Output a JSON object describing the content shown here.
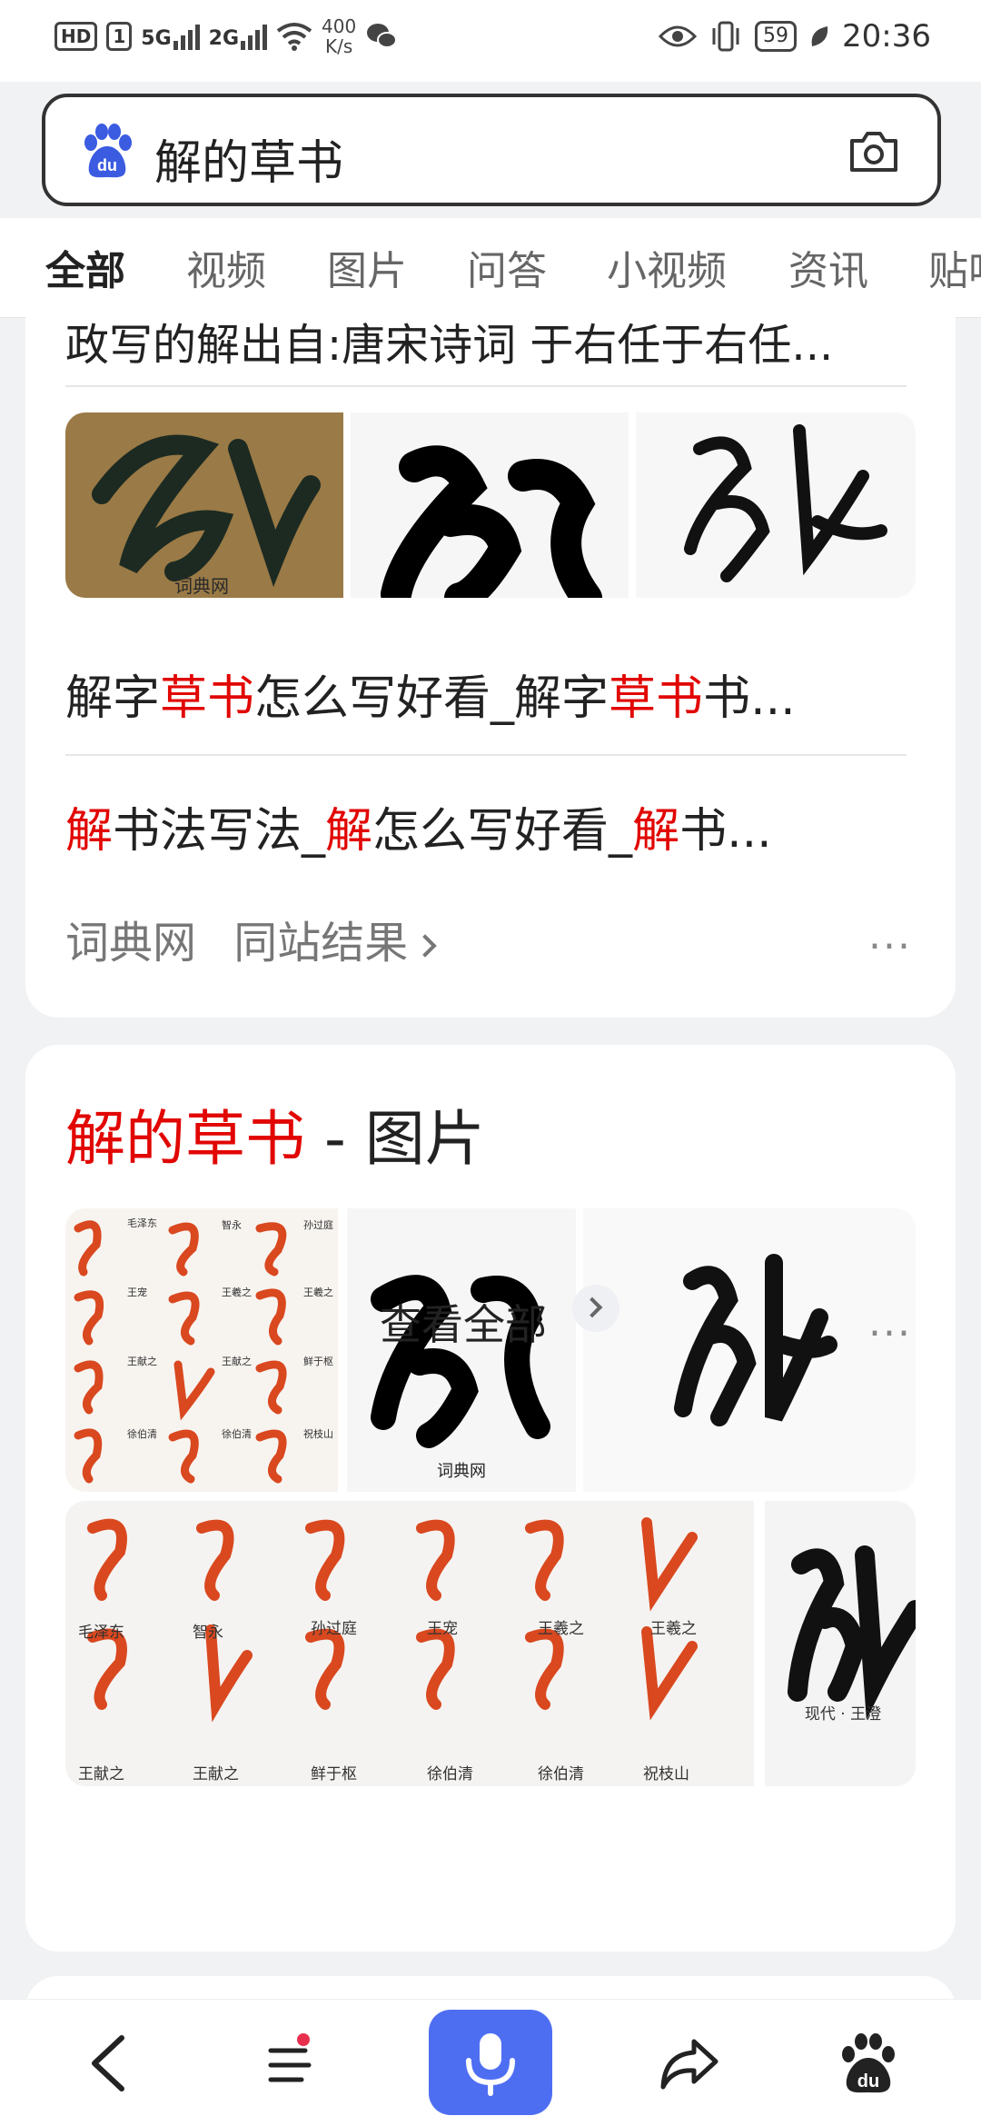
{
  "status_bar": {
    "hd": "HD",
    "sim1": "1",
    "net1": "5G",
    "net2": "2G",
    "speed_value": "400",
    "speed_unit": "K/s",
    "battery": "59",
    "time": "20:36"
  },
  "search": {
    "query": "解的草书"
  },
  "tabs": [
    "全部",
    "视频",
    "图片",
    "问答",
    "小视频",
    "资讯",
    "贴吧"
  ],
  "card1": {
    "cut_text": "政写的解出自:唐宋诗词 于右任于右任...",
    "thumb_watermark": "词典网",
    "link1": {
      "p1": "解字",
      "h1": "草书",
      "p2": "怎么写好看_解字",
      "h2": "草书",
      "p3": "书..."
    },
    "link2": {
      "h1": "解",
      "p1": "书法写法_",
      "h2": "解",
      "p2": "怎么写好看_",
      "h3": "解",
      "p3": "书..."
    },
    "source_name": "词典网",
    "same_site": "同站结果",
    "more": "..."
  },
  "card2": {
    "title_highlight": "解的草书",
    "title_rest": " - 图片",
    "grid_labels": [
      "毛泽东",
      "智永",
      "孙过庭",
      "王宠",
      "王羲之",
      "王羲之",
      "王献之",
      "王献之",
      "鲜于枢",
      "徐伯清",
      "徐伯清",
      "祝枝山"
    ],
    "img2_watermark": "词典网",
    "wide_labels_top": [
      "毛泽东",
      "智永",
      "孙过庭",
      "王宠",
      "王羲之",
      "王羲之"
    ],
    "wide_labels_bottom": [
      "王献之",
      "王献之",
      "鲜于枢",
      "徐伯清",
      "徐伯清",
      "祝枝山"
    ],
    "side_caption": "现代 · 王澄",
    "view_all": "查看全部",
    "more": "..."
  },
  "colors": {
    "accent": "#4e6ef2",
    "highlight": "#e10602",
    "calligraphy_red": "#d9481f"
  }
}
